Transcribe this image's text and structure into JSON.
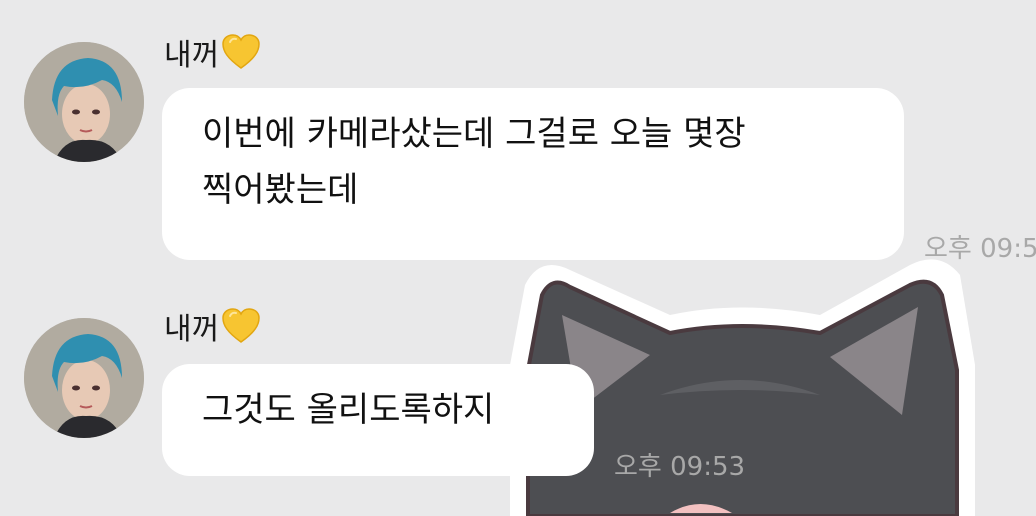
{
  "chat": {
    "messages": [
      {
        "sender": "내꺼",
        "lines": [
          "이번에 카메라샀는데 그걸로 오늘 몇장",
          "찍어봤는데"
        ],
        "time": "오후 09:5"
      },
      {
        "sender": "내꺼",
        "lines": [
          "그것도 올리도록하지"
        ],
        "time": "오후 09:53"
      }
    ]
  },
  "colors": {
    "background": "#e9e9ea",
    "bubble": "#ffffff",
    "heart": "#f7c531",
    "timestamp": "#a8a8a8",
    "avatar_hair": "#2f8fb0"
  },
  "icons": {
    "sender_badge": "yellow-heart-icon",
    "sticker": "black-cat-sticker"
  }
}
